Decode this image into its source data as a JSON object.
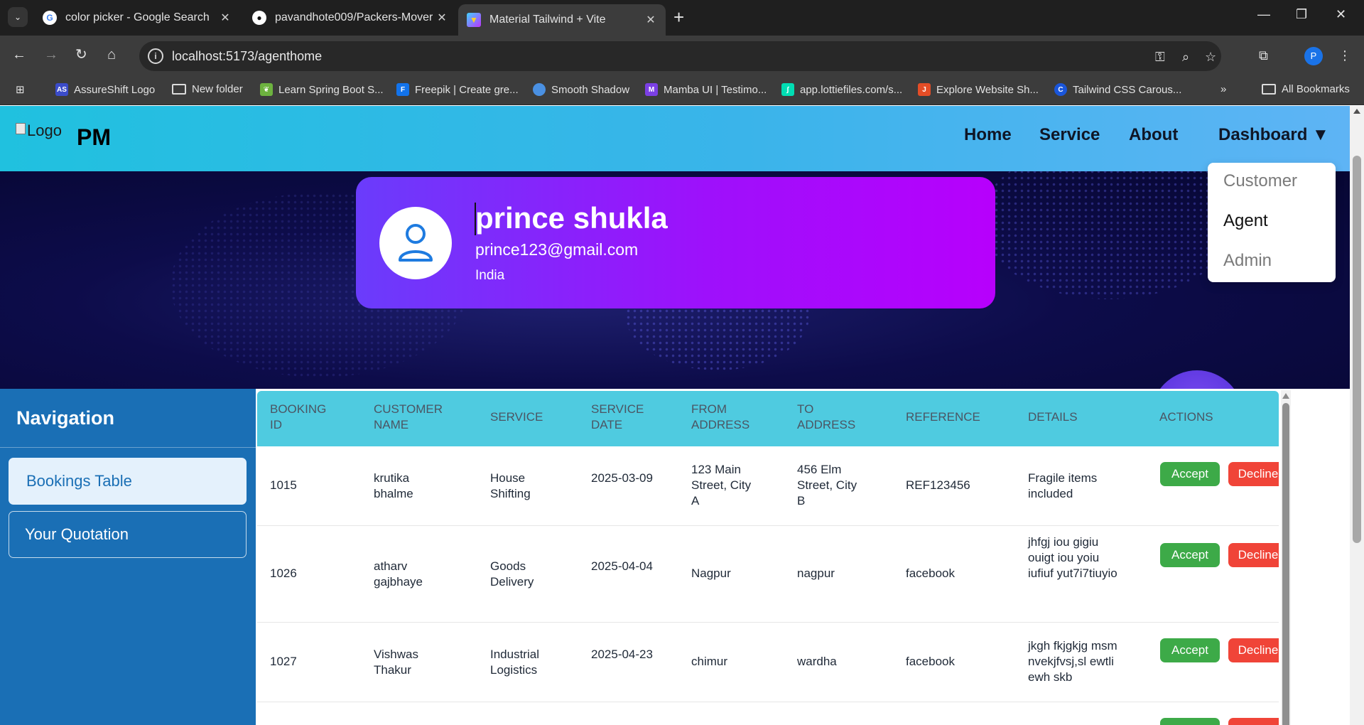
{
  "browser": {
    "tabs": [
      {
        "title": "color picker - Google Search",
        "favicon": "google-icon"
      },
      {
        "title": "pavandhote009/Packers-Movers",
        "favicon": "github-icon"
      },
      {
        "title": "Material Tailwind + Vite",
        "favicon": "vite-icon",
        "active": true
      }
    ],
    "url": "localhost:5173/agenthome",
    "profile_initial": "P",
    "bookmarks": [
      {
        "label": "AssureShift Logo",
        "icon": "AS",
        "color": "#3b4cca"
      },
      {
        "label": "New folder",
        "icon": "folder"
      },
      {
        "label": "Learn Spring Boot S...",
        "icon": "spring",
        "color": "#6db33f"
      },
      {
        "label": "Freepik | Create gre...",
        "icon": "F",
        "color": "#1273eb"
      },
      {
        "label": "Smooth Shadow",
        "icon": "ss",
        "color": "#4a90e2"
      },
      {
        "label": "Mamba UI | Testimo...",
        "icon": "M",
        "color": "#7b3fe4"
      },
      {
        "label": "app.lottiefiles.com/s...",
        "icon": "L",
        "color": "#00ddb3"
      },
      {
        "label": "Explore Website Sh...",
        "icon": "J",
        "color": "#e44d26"
      },
      {
        "label": "Tailwind CSS Carous...",
        "icon": "T",
        "color": "#1a56db"
      }
    ],
    "all_bookmarks": "All Bookmarks"
  },
  "header": {
    "logo_alt": "Logo",
    "brand": "PM",
    "menu": [
      "Home",
      "Service",
      "About",
      "Dashboard ▼"
    ],
    "dropdown": [
      "Customer",
      "Agent",
      "Admin"
    ]
  },
  "profile": {
    "name": "prince shukla",
    "email": "prince123@gmail.com",
    "country": "India"
  },
  "sidebar": {
    "title": "Navigation",
    "items": [
      "Bookings Table",
      "Your Quotation"
    ]
  },
  "table": {
    "columns": [
      "BOOKING ID",
      "CUSTOMER NAME",
      "SERVICE",
      "SERVICE DATE",
      "FROM ADDRESS",
      "TO ADDRESS",
      "REFERENCE",
      "DETAILS",
      "ACTIONS"
    ],
    "accept_label": "Accept",
    "decline_label": "Decline",
    "rows": [
      {
        "id": "1015",
        "name": "krutika bhalme",
        "service": "House Shifting",
        "date": "2025-03-09",
        "from": "123 Main Street, City A",
        "to": "456 Elm Street, City B",
        "reference": "REF123456",
        "details": "Fragile items included"
      },
      {
        "id": "1026",
        "name": "atharv gajbhaye",
        "service": "Goods Delivery",
        "date": "2025-04-04",
        "from": "Nagpur",
        "to": "nagpur",
        "reference": "facebook",
        "details": "jhfgj iou gigiu ouigt iou yoiu iufiuf yut7i7tiuyio"
      },
      {
        "id": "1027",
        "name": "Vishwas Thakur",
        "service": "Industrial Logistics",
        "date": "2025-04-23",
        "from": "chimur",
        "to": "wardha",
        "reference": "facebook",
        "details": "jkgh fkjgkjg msmnvekjfvsj,sl ewtliewh skb"
      }
    ]
  }
}
